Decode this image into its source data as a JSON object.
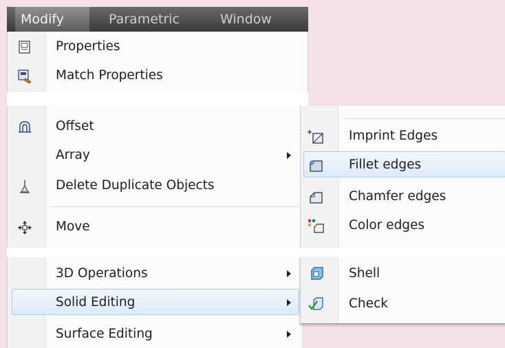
{
  "menubar": {
    "items": [
      "Modify",
      "Parametric",
      "Window"
    ]
  },
  "menu": {
    "top": [
      {
        "label": "Properties",
        "icon": "properties-icon"
      },
      {
        "label": "Match Properties",
        "icon": "match-properties-icon"
      }
    ],
    "middle": [
      {
        "label": "Offset",
        "icon": "offset-icon"
      },
      {
        "label": "Array",
        "icon": "",
        "submenu": true
      },
      {
        "label": "Delete Duplicate Objects",
        "icon": "delete-duplicates-icon"
      },
      {
        "label": "Move",
        "icon": "move-icon"
      }
    ],
    "bottom": [
      {
        "label": "3D Operations",
        "submenu": true
      },
      {
        "label": "Solid Editing",
        "submenu": true,
        "highlighted": true
      },
      {
        "label": "Surface Editing",
        "submenu": true
      }
    ]
  },
  "submenu": {
    "items": [
      {
        "label": "Imprint Edges",
        "icon": "imprint-edges-icon"
      },
      {
        "label": "Fillet edges",
        "icon": "fillet-edges-icon",
        "highlighted": true
      },
      {
        "label": "Chamfer edges",
        "icon": "chamfer-edges-icon"
      },
      {
        "label": "Color edges",
        "icon": "color-edges-icon"
      },
      {
        "label": "Shell",
        "icon": "shell-icon"
      },
      {
        "label": "Check",
        "icon": "check-icon"
      }
    ]
  },
  "colors": {
    "background": "#f4e1e6",
    "menubar": "#4a4a4a",
    "highlight_border": "#a9c9e8",
    "highlight_fill": "#e6f1fb"
  }
}
